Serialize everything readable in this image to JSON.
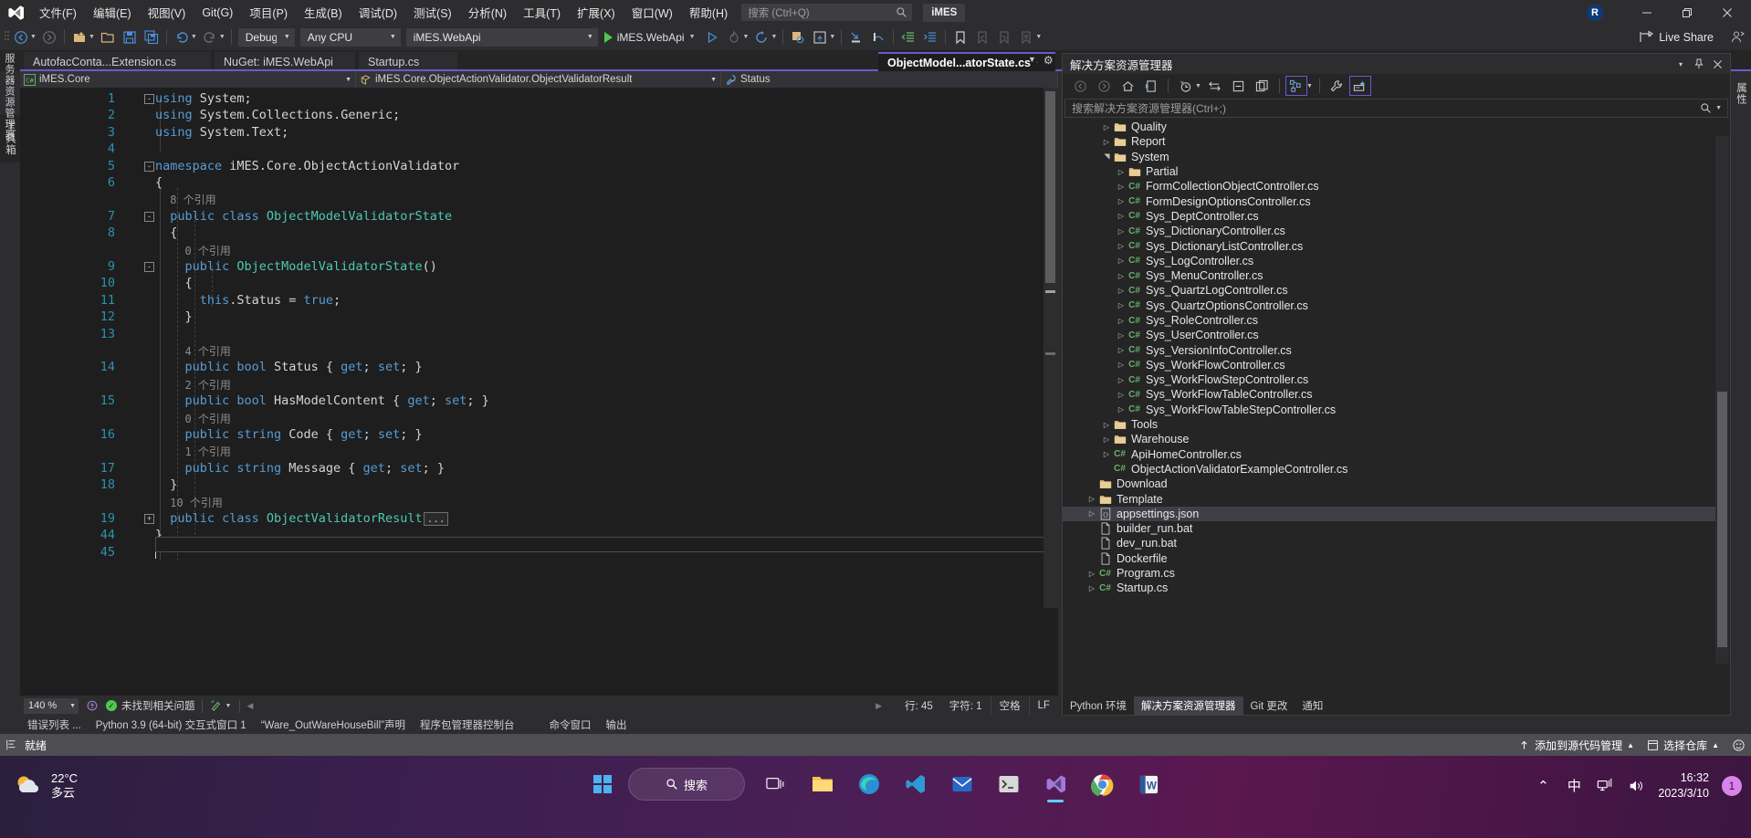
{
  "titlebar": {
    "app_icon": "visual-studio-logo",
    "menus": [
      "文件(F)",
      "编辑(E)",
      "视图(V)",
      "Git(G)",
      "项目(P)",
      "生成(B)",
      "调试(D)",
      "测试(S)",
      "分析(N)",
      "工具(T)",
      "扩展(X)",
      "窗口(W)",
      "帮助(H)"
    ],
    "search_placeholder": "搜索 (Ctrl+Q)",
    "search_value": "",
    "solution_badge": "iMES",
    "account_initial": "R",
    "minimize": "—",
    "maximize": "▢",
    "close": "✕"
  },
  "toolbar": {
    "config": "Debug",
    "platform": "Any CPU",
    "startup_project": "iMES.WebApi",
    "run_label": "iMES.WebApi",
    "live_share": "Live Share"
  },
  "tabs": {
    "items": [
      {
        "label": "AutofacConta...Extension.cs",
        "active": false
      },
      {
        "label": "NuGet: iMES.WebApi",
        "active": false
      },
      {
        "label": "Startup.cs",
        "active": false
      }
    ],
    "active_tab": {
      "label": "ObjectModel...atorState.cs",
      "pin": "📌",
      "close": "✕",
      "menu": "▾",
      "gear": "⚙"
    }
  },
  "left_dock": {
    "tabs": [
      "服务器资源管理器",
      "工具箱"
    ]
  },
  "right_dock": {
    "tabs": [
      "属性"
    ]
  },
  "editor": {
    "navbar": {
      "project": "iMES.Core",
      "type": "iMES.Core.ObjectActionValidator.ObjectValidatorResult",
      "member": "Status"
    },
    "lines": [
      {
        "n": "1",
        "fold": "-",
        "indent": 0,
        "tokens": [
          [
            "kw",
            "using"
          ],
          [
            "id",
            " System;"
          ]
        ]
      },
      {
        "n": "2",
        "fold": "",
        "indent": 0,
        "tokens": [
          [
            "kw",
            "using"
          ],
          [
            "id",
            " System.Collections.Generic;"
          ]
        ]
      },
      {
        "n": "3",
        "fold": "",
        "indent": 0,
        "tokens": [
          [
            "kw",
            "using"
          ],
          [
            "id",
            " System.Text;"
          ]
        ]
      },
      {
        "n": "4",
        "fold": "",
        "indent": 0,
        "tokens": []
      },
      {
        "n": "5",
        "fold": "-",
        "indent": 0,
        "tokens": [
          [
            "kw",
            "namespace"
          ],
          [
            "id",
            " iMES.Core.ObjectActionValidator"
          ]
        ]
      },
      {
        "n": "6",
        "fold": "",
        "indent": 0,
        "tokens": [
          [
            "pn",
            "{"
          ]
        ]
      },
      {
        "n": "",
        "fold": "",
        "indent": 1,
        "lens": "8 个引用"
      },
      {
        "n": "7",
        "fold": "-",
        "indent": 1,
        "tokens": [
          [
            "kw",
            "public class"
          ],
          [
            "ty",
            " ObjectModelValidatorState"
          ]
        ]
      },
      {
        "n": "8",
        "fold": "",
        "indent": 1,
        "tokens": [
          [
            "pn",
            "{"
          ]
        ]
      },
      {
        "n": "",
        "fold": "",
        "indent": 2,
        "lens": "0 个引用"
      },
      {
        "n": "9",
        "fold": "-",
        "indent": 2,
        "tokens": [
          [
            "kw",
            "public"
          ],
          [
            "ty",
            " ObjectModelValidatorState"
          ],
          [
            "pn",
            "()"
          ]
        ]
      },
      {
        "n": "10",
        "fold": "",
        "indent": 2,
        "tokens": [
          [
            "pn",
            "{"
          ]
        ]
      },
      {
        "n": "11",
        "fold": "",
        "indent": 3,
        "tokens": [
          [
            "kw",
            "this"
          ],
          [
            "id",
            ".Status = "
          ],
          [
            "kw",
            "true"
          ],
          [
            "id",
            ";"
          ]
        ]
      },
      {
        "n": "12",
        "fold": "",
        "indent": 2,
        "tokens": [
          [
            "pn",
            "}"
          ]
        ]
      },
      {
        "n": "13",
        "fold": "",
        "indent": 0,
        "tokens": []
      },
      {
        "n": "",
        "fold": "",
        "indent": 2,
        "lens": "4 个引用"
      },
      {
        "n": "14",
        "fold": "",
        "indent": 2,
        "tokens": [
          [
            "kw",
            "public bool"
          ],
          [
            "id",
            " Status { "
          ],
          [
            "kw",
            "get"
          ],
          [
            "id",
            "; "
          ],
          [
            "kw",
            "set"
          ],
          [
            "id",
            "; }"
          ]
        ]
      },
      {
        "n": "",
        "fold": "",
        "indent": 2,
        "lens": "2 个引用"
      },
      {
        "n": "15",
        "fold": "",
        "indent": 2,
        "tokens": [
          [
            "kw",
            "public bool"
          ],
          [
            "id",
            " HasModelContent { "
          ],
          [
            "kw",
            "get"
          ],
          [
            "id",
            "; "
          ],
          [
            "kw",
            "set"
          ],
          [
            "id",
            "; }"
          ]
        ]
      },
      {
        "n": "",
        "fold": "",
        "indent": 2,
        "lens": "0 个引用"
      },
      {
        "n": "16",
        "fold": "",
        "indent": 2,
        "tokens": [
          [
            "kw",
            "public string"
          ],
          [
            "id",
            " Code { "
          ],
          [
            "kw",
            "get"
          ],
          [
            "id",
            "; "
          ],
          [
            "kw",
            "set"
          ],
          [
            "id",
            "; }"
          ]
        ]
      },
      {
        "n": "",
        "fold": "",
        "indent": 2,
        "lens": "1 个引用"
      },
      {
        "n": "17",
        "fold": "",
        "indent": 2,
        "tokens": [
          [
            "kw",
            "public string"
          ],
          [
            "id",
            " Message { "
          ],
          [
            "kw",
            "get"
          ],
          [
            "id",
            "; "
          ],
          [
            "kw",
            "set"
          ],
          [
            "id",
            "; }"
          ]
        ]
      },
      {
        "n": "18",
        "fold": "",
        "indent": 1,
        "tokens": [
          [
            "pn",
            "}"
          ]
        ]
      },
      {
        "n": "",
        "fold": "",
        "indent": 1,
        "lens": "10 个引用"
      },
      {
        "n": "19",
        "fold": "+",
        "indent": 1,
        "tokens": [
          [
            "kw",
            "public class"
          ],
          [
            "ty",
            " ObjectValidatorResult"
          ]
        ],
        "collapsed": "..."
      },
      {
        "n": "44",
        "fold": "",
        "indent": 0,
        "tokens": [
          [
            "pn",
            "}"
          ]
        ]
      },
      {
        "n": "45",
        "fold": "",
        "indent": 0,
        "tokens": [],
        "cursor": true
      }
    ],
    "status": {
      "zoom": "140 %",
      "issues": "未找到相关问题",
      "line_label": "行: 45",
      "col_label": "字符: 1",
      "spaces": "空格",
      "eol": "LF"
    }
  },
  "bottom_dock": {
    "tabs": [
      "错误列表 ...",
      "Python 3.9 (64-bit) 交互式窗口 1",
      "“Ware_OutWareHouseBill”声明",
      "程序包管理器控制台",
      "命令窗口",
      "输出"
    ]
  },
  "solution_explorer": {
    "title": "解决方案资源管理器",
    "search_placeholder": "搜索解决方案资源管理器(Ctrl+;)",
    "collapse": "▾",
    "pin": "⚲",
    "close": "✕",
    "tree": [
      {
        "label": "Quality",
        "icon": "folder",
        "arrow": "closed",
        "depth": 2
      },
      {
        "label": "Report",
        "icon": "folder",
        "arrow": "closed",
        "depth": 2
      },
      {
        "label": "System",
        "icon": "folder",
        "arrow": "open",
        "depth": 2
      },
      {
        "label": "Partial",
        "icon": "folder",
        "arrow": "closed",
        "depth": 3
      },
      {
        "label": "FormCollectionObjectController.cs",
        "icon": "csharp",
        "arrow": "closed",
        "depth": 3
      },
      {
        "label": "FormDesignOptionsController.cs",
        "icon": "csharp",
        "arrow": "closed",
        "depth": 3
      },
      {
        "label": "Sys_DeptController.cs",
        "icon": "csharp",
        "arrow": "closed",
        "depth": 3
      },
      {
        "label": "Sys_DictionaryController.cs",
        "icon": "csharp",
        "arrow": "closed",
        "depth": 3
      },
      {
        "label": "Sys_DictionaryListController.cs",
        "icon": "csharp",
        "arrow": "closed",
        "depth": 3
      },
      {
        "label": "Sys_LogController.cs",
        "icon": "csharp",
        "arrow": "closed",
        "depth": 3
      },
      {
        "label": "Sys_MenuController.cs",
        "icon": "csharp",
        "arrow": "closed",
        "depth": 3
      },
      {
        "label": "Sys_QuartzLogController.cs",
        "icon": "csharp",
        "arrow": "closed",
        "depth": 3
      },
      {
        "label": "Sys_QuartzOptionsController.cs",
        "icon": "csharp",
        "arrow": "closed",
        "depth": 3
      },
      {
        "label": "Sys_RoleController.cs",
        "icon": "csharp",
        "arrow": "closed",
        "depth": 3
      },
      {
        "label": "Sys_UserController.cs",
        "icon": "csharp",
        "arrow": "closed",
        "depth": 3
      },
      {
        "label": "Sys_VersionInfoController.cs",
        "icon": "csharp",
        "arrow": "closed",
        "depth": 3
      },
      {
        "label": "Sys_WorkFlowController.cs",
        "icon": "csharp",
        "arrow": "closed",
        "depth": 3
      },
      {
        "label": "Sys_WorkFlowStepController.cs",
        "icon": "csharp",
        "arrow": "closed",
        "depth": 3
      },
      {
        "label": "Sys_WorkFlowTableController.cs",
        "icon": "csharp",
        "arrow": "closed",
        "depth": 3
      },
      {
        "label": "Sys_WorkFlowTableStepController.cs",
        "icon": "csharp",
        "arrow": "closed",
        "depth": 3
      },
      {
        "label": "Tools",
        "icon": "folder",
        "arrow": "closed",
        "depth": 2
      },
      {
        "label": "Warehouse",
        "icon": "folder",
        "arrow": "closed",
        "depth": 2
      },
      {
        "label": "ApiHomeController.cs",
        "icon": "csharp",
        "arrow": "closed",
        "depth": 2
      },
      {
        "label": "ObjectActionValidatorExampleController.cs",
        "icon": "csharp",
        "arrow": "none",
        "depth": 2
      },
      {
        "label": "Download",
        "icon": "folder",
        "arrow": "none",
        "depth": 1
      },
      {
        "label": "Template",
        "icon": "folder",
        "arrow": "closed",
        "depth": 1
      },
      {
        "label": "appsettings.json",
        "icon": "json",
        "arrow": "closed",
        "depth": 1,
        "selected": true
      },
      {
        "label": "builder_run.bat",
        "icon": "file",
        "arrow": "none",
        "depth": 1
      },
      {
        "label": "dev_run.bat",
        "icon": "file",
        "arrow": "none",
        "depth": 1
      },
      {
        "label": "Dockerfile",
        "icon": "file",
        "arrow": "none",
        "depth": 1
      },
      {
        "label": "Program.cs",
        "icon": "csharp",
        "arrow": "closed",
        "depth": 1
      },
      {
        "label": "Startup.cs",
        "icon": "csharp",
        "arrow": "closed",
        "depth": 1
      }
    ],
    "bottom_tabs": [
      {
        "label": "Python 环境",
        "active": false
      },
      {
        "label": "解决方案资源管理器",
        "active": true
      },
      {
        "label": "Git 更改",
        "active": false
      },
      {
        "label": "通知",
        "active": false
      }
    ]
  },
  "status_bar": {
    "ready": "就绪",
    "source_control": "添加到源代码管理",
    "select_repo": "选择仓库",
    "caret_up": "▴"
  },
  "taskbar": {
    "weather_temp": "22°C",
    "weather_desc": "多云",
    "search_label": "搜索",
    "apps": [
      {
        "name": "start-button",
        "glyph": "⊞"
      },
      {
        "name": "task-view",
        "glyph": "▭"
      },
      {
        "name": "file-explorer",
        "glyph": "📁"
      },
      {
        "name": "edge-browser",
        "glyph": "e"
      },
      {
        "name": "vscode",
        "glyph": "</>"
      },
      {
        "name": "foxmail",
        "glyph": "✉"
      },
      {
        "name": "terminal",
        "glyph": "▣"
      },
      {
        "name": "visual-studio",
        "glyph": "∞"
      },
      {
        "name": "chrome",
        "glyph": "◉"
      },
      {
        "name": "word",
        "glyph": "W"
      }
    ],
    "tray": {
      "chevron": "⌃",
      "ime": "中",
      "network": "network-icon",
      "volume": "volume-icon",
      "time": "16:32",
      "date": "2023/3/10",
      "notification_count": "1"
    }
  },
  "colors": {
    "accent": "#6a5acd",
    "status_purple": "#68217a",
    "chrome": "#2d2d30",
    "editor_bg": "#1e1e1e",
    "panel_bg": "#252526",
    "keyword": "#569cd6",
    "type": "#4ec9b0",
    "linenum": "#2b91af",
    "codelens": "#8b8b8b"
  }
}
